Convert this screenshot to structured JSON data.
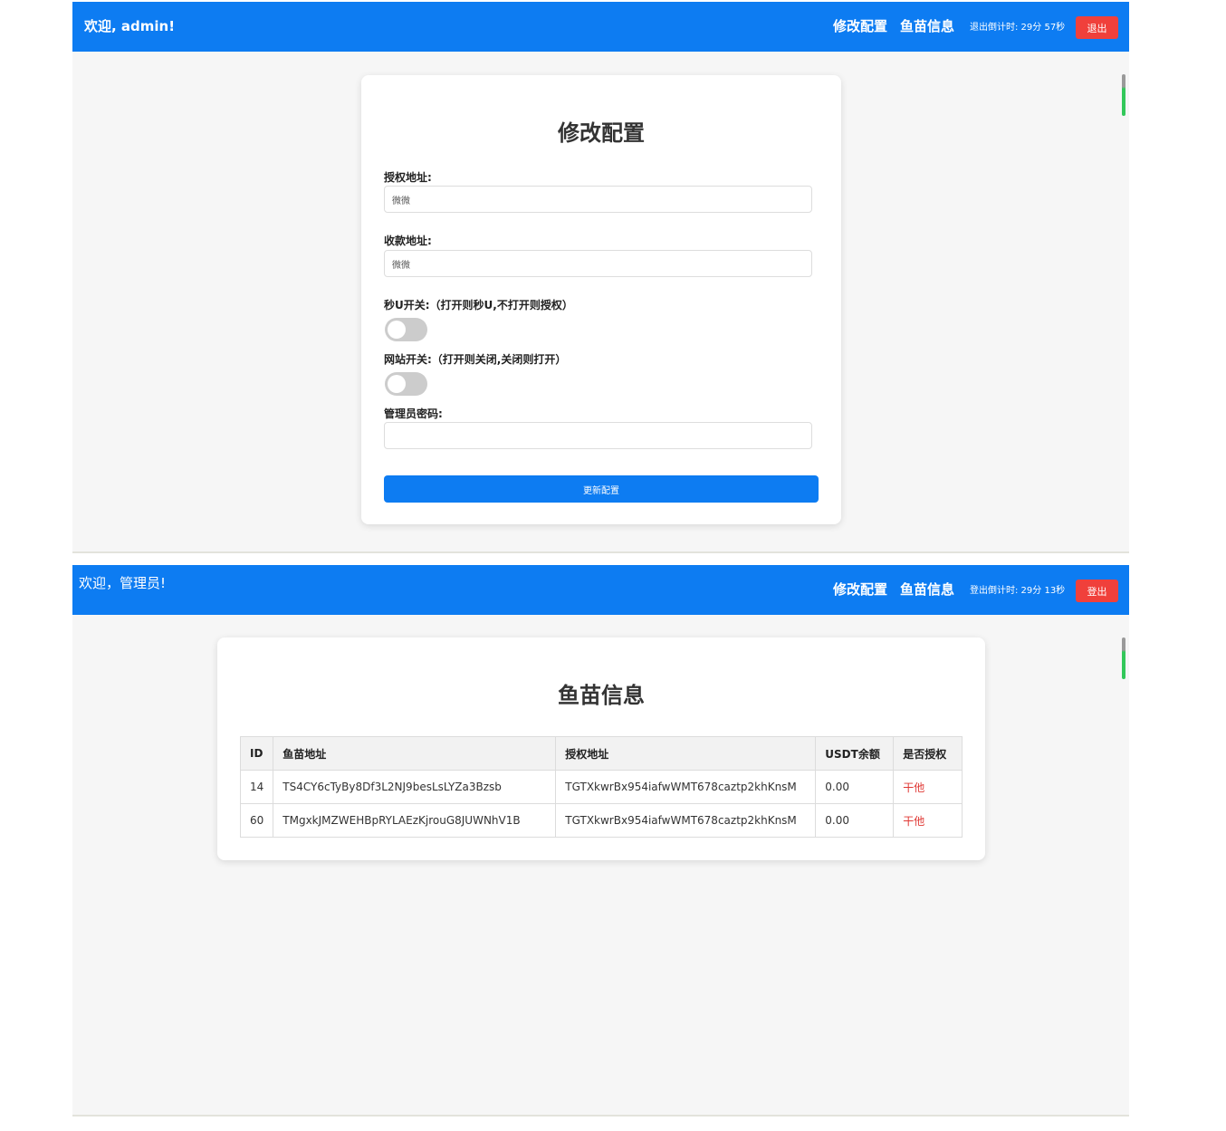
{
  "screen1": {
    "header": {
      "welcome": "欢迎, admin!",
      "nav_config": "修改配置",
      "nav_fish": "鱼苗信息",
      "countdown": "退出倒计时:  29分 57秒",
      "logout": "退出"
    },
    "form": {
      "title": "修改配置",
      "auth_label": "授权地址:",
      "auth_value": "微微",
      "pay_label": "收款地址:",
      "pay_value": "微微",
      "secu_label": "秒U开关:（打开则秒U,不打开则授权）",
      "secu_on": false,
      "site_label": "网站开关:（打开则关闭,关闭则打开）",
      "site_on": false,
      "pwd_label": "管理员密码:",
      "pwd_value": "",
      "submit": "更新配置"
    }
  },
  "screen2": {
    "header": {
      "welcome": "欢迎，管理员!",
      "nav_config": "修改配置",
      "nav_fish": "鱼苗信息",
      "countdown": "登出倒计时:  29分 13秒",
      "logout": "登出"
    },
    "table": {
      "title": "鱼苗信息",
      "headers": [
        "ID",
        "鱼苗地址",
        "授权地址",
        "USDT余额",
        "是否授权"
      ],
      "rows": [
        [
          "14",
          "TS4CY6cTyBy8Df3L2NJ9besLsLYZa3Bzsb",
          "TGTXkwrBx954iafwWMT678caztp2khKnsM",
          "0.00",
          "干他"
        ],
        [
          "60",
          "TMgxkJMZWEHBpRYLAEzKjrouG8JUWNhV1B",
          "TGTXkwrBx954iafwWMT678caztp2khKnsM",
          "0.00",
          "干他"
        ]
      ]
    }
  },
  "colors": {
    "header_bg": "#0d7cf2",
    "logout_bg": "#f0403b",
    "auth_text": "#e03a36"
  }
}
